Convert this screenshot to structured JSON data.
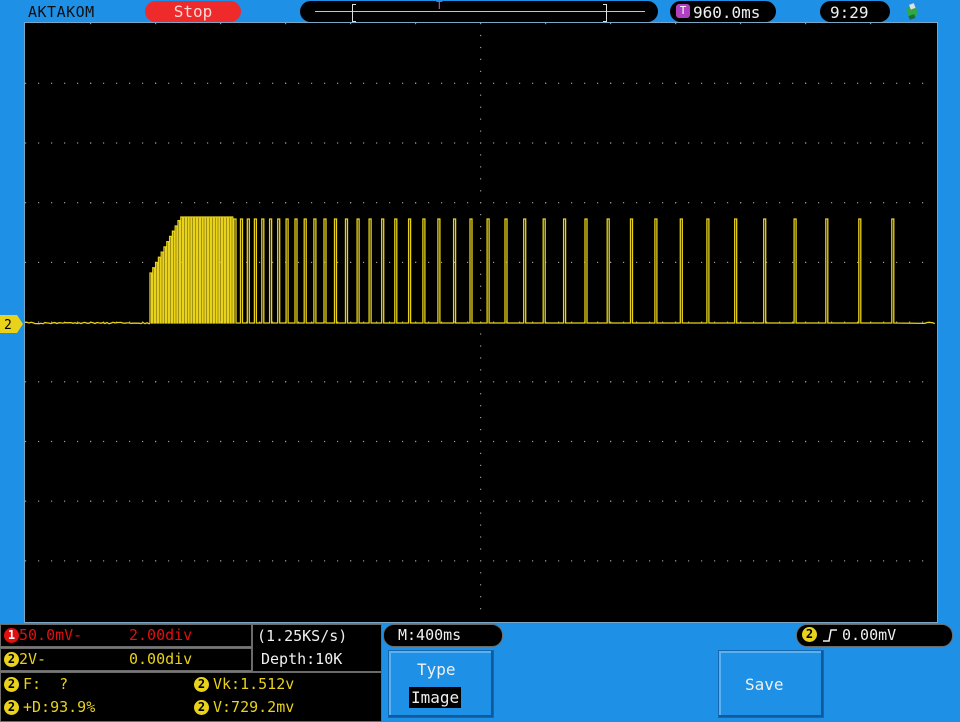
{
  "header": {
    "brand": "AKTAKOM",
    "run_state": "Stop",
    "trigger_delay": "960.0ms",
    "clock": "9:29",
    "timebase_marker": "T"
  },
  "channel_marker": "2",
  "colors": {
    "trace": "#e8d21a",
    "background": "#1e90e6",
    "stop": "#ee2a2a",
    "ch1": "#e01010"
  },
  "ch1": {
    "num": "1",
    "scale": "50.0mV-",
    "offset": "2.00div"
  },
  "ch2": {
    "num": "2",
    "scale": "2V-",
    "offset": "0.00div"
  },
  "acquisition": {
    "sample_rate": "(1.25KS/s)",
    "depth": "Depth:10K"
  },
  "timebase": "M:400ms",
  "trigger": {
    "num": "2",
    "edge_icon": "rising-edge-icon",
    "level": "0.00mV"
  },
  "measurements": [
    {
      "num": "2",
      "label": "F:  ?"
    },
    {
      "num": "2",
      "label": "Vk:1.512v"
    },
    {
      "num": "2",
      "label": "+D:93.9%"
    },
    {
      "num": "2",
      "label": "V:729.2mv"
    }
  ],
  "softkeys": {
    "type_label": "Type",
    "type_value": "Image",
    "save_label": "Save"
  }
}
